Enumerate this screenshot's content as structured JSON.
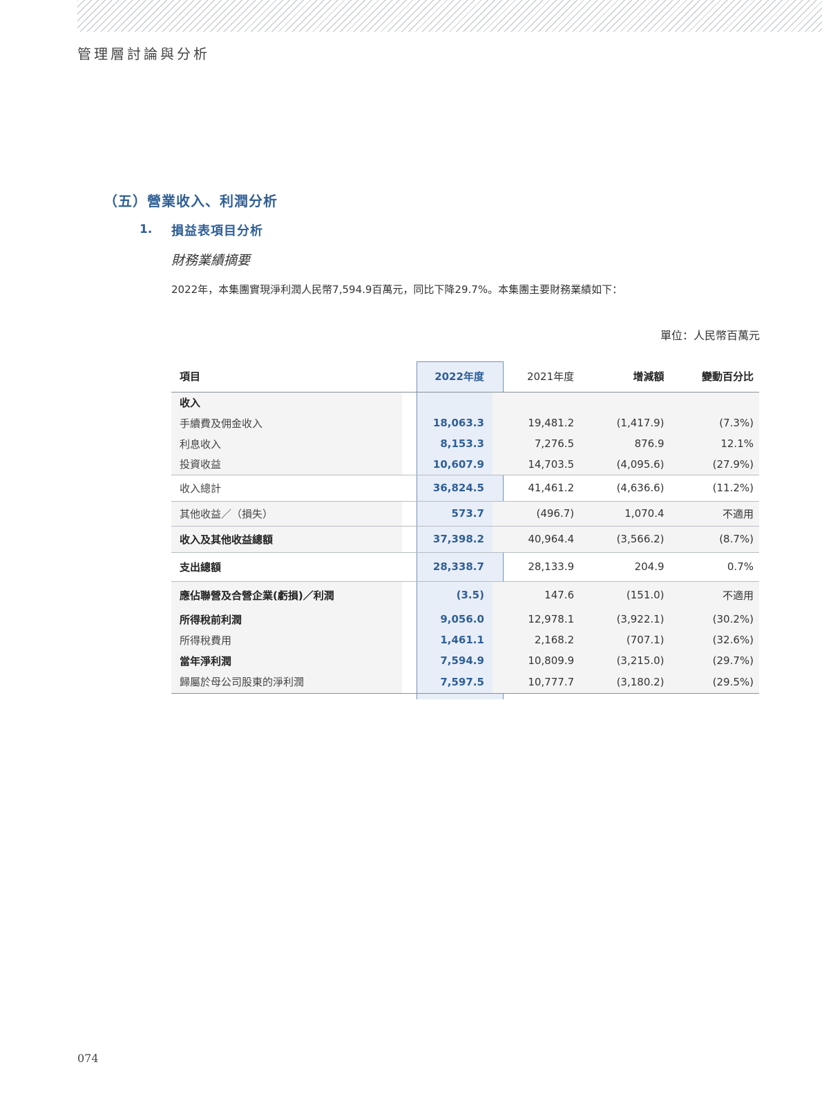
{
  "header": {
    "title": "管理層討論與分析"
  },
  "section": {
    "title": "（五）營業收入、利潤分析",
    "sub_num": "1.",
    "sub_title": "損益表項目分析",
    "italic_title": "財務業績摘要",
    "paragraph": "2022年，本集團實現淨利潤人民幣7,594.9百萬元，同比下降29.7%。本集團主要財務業績如下：",
    "unit": "單位：人民幣百萬元"
  },
  "table": {
    "headers": [
      "項目",
      "2022年度",
      "2021年度",
      "增減額",
      "變動百分比"
    ],
    "rows": [
      {
        "label": "收入",
        "v2022": "",
        "v2021": "",
        "change": "",
        "pct": ""
      },
      {
        "label": "手續費及佣金收入",
        "v2022": "18,063.3",
        "v2021": "19,481.2",
        "change": "(1,417.9)",
        "pct": "(7.3%)"
      },
      {
        "label": "利息收入",
        "v2022": "8,153.3",
        "v2021": "7,276.5",
        "change": "876.9",
        "pct": "12.1%"
      },
      {
        "label": "投資收益",
        "v2022": "10,607.9",
        "v2021": "14,703.5",
        "change": "(4,095.6)",
        "pct": "(27.9%)"
      },
      {
        "label": "收入總計",
        "v2022": "36,824.5",
        "v2021": "41,461.2",
        "change": "(4,636.6)",
        "pct": "(11.2%)"
      },
      {
        "label": "其他收益／（損失）",
        "v2022": "573.7",
        "v2021": "(496.7)",
        "change": "1,070.4",
        "pct": "不適用"
      },
      {
        "label": "收入及其他收益總額",
        "v2022": "37,398.2",
        "v2021": "40,964.4",
        "change": "(3,566.2)",
        "pct": "(8.7%)"
      },
      {
        "label": "支出總額",
        "v2022": "28,338.7",
        "v2021": "28,133.9",
        "change": "204.9",
        "pct": "0.7%"
      },
      {
        "label": "應佔聯營及合營企業(虧損)／利潤",
        "v2022": "(3.5)",
        "v2021": "147.6",
        "change": "(151.0)",
        "pct": "不適用"
      },
      {
        "label": "所得稅前利潤",
        "v2022": "9,056.0",
        "v2021": "12,978.1",
        "change": "(3,922.1)",
        "pct": "(30.2%)"
      },
      {
        "label": "所得稅費用",
        "v2022": "1,461.1",
        "v2021": "2,168.2",
        "change": "(707.1)",
        "pct": "(32.6%)"
      },
      {
        "label": "當年淨利潤",
        "v2022": "7,594.9",
        "v2021": "10,809.9",
        "change": "(3,215.0)",
        "pct": "(29.7%)"
      },
      {
        "label": "歸屬於母公司股東的淨利潤",
        "v2022": "7,597.5",
        "v2021": "10,777.7",
        "change": "(3,180.2)",
        "pct": "(29.5%)"
      }
    ]
  },
  "page_number": "074",
  "colors": {
    "accent": "#2f5f96",
    "highlight": "#e8eef7",
    "row_grey": "#f4f4f4"
  }
}
